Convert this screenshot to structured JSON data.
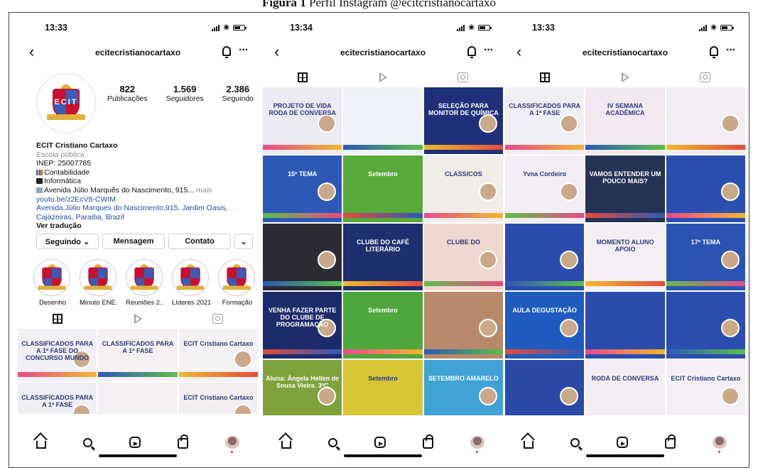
{
  "caption": {
    "bold": "Figura 1",
    "text": "Perfil Instagram @ecitcristianocartaxo"
  },
  "phones": [
    {
      "time": "13:33",
      "username": "ecitecristianocartaxo"
    },
    {
      "time": "13:34",
      "username": "ecitecristianocartaxo"
    },
    {
      "time": "13:33",
      "username": "ecitecristianocartaxo"
    }
  ],
  "profile": {
    "logo_letters": "ECIT",
    "stats": [
      {
        "value": "822",
        "label": "Publicações"
      },
      {
        "value": "1.569",
        "label": "Seguidores"
      },
      {
        "value": "2.386",
        "label": "Seguindo"
      }
    ],
    "name": "ECIT Cristiano Cartaxo",
    "category": "Escola pública",
    "inep": "INEP: 25007785",
    "line_contabilidade": "Contabilidade",
    "line_informatica": "Informática",
    "address_short": "Avenida Júlio Marquês do Nascimento, 915...",
    "more": "mais",
    "link": "youtu.be/z2EcV8-CWIM",
    "address_link": "Avenida Júlio Marques do Nascimento,915, Jardim Oasis, Cajàzeiras, Paraiba, Brazil",
    "translate": "Ver tradução",
    "buttons": {
      "following": "Seguindo ⌄",
      "message": "Mensagem",
      "contact": "Contato",
      "chevron": "⌄"
    },
    "highlights": [
      "Desenho",
      "Minuto ENE...",
      "Reuniões 2...",
      "Líderes 2021",
      "Formação"
    ]
  },
  "posts": {
    "p1": [
      {
        "text": "CLASSIFICADOS PARA A 1ª FASE DO CONCURSO MUNDO",
        "color": "#f3eff7"
      },
      {
        "text": "CLASSIFICADOS PARA A 1ª FASE",
        "color": "#f7f1f4"
      },
      {
        "text": "ECIT Cristiano Cartaxo",
        "color": "#f5f2f6"
      },
      {
        "text": "CLASSIFICADOS PARA A 1ª FASE",
        "color": "#efeef5"
      },
      {
        "text": "",
        "color": "#f4f0f4"
      },
      {
        "text": "ECIT Cristiano Cartaxo",
        "color": "#f4eef2"
      }
    ],
    "p2": [
      {
        "text": "PROJETO DE VIDA RODA DE CONVERSA",
        "color": "#ecebf4"
      },
      {
        "text": "",
        "color": "#eef1f7"
      },
      {
        "text": "SELEÇÃO PARA MONITOR DE QUÍMICA",
        "color": "#1f2f7a"
      },
      {
        "text": "15º TEMA",
        "color": "#2e58b5"
      },
      {
        "text": "Setembro",
        "color": "#57a93a"
      },
      {
        "text": "CLASSICOS",
        "color": "#f2ede8"
      },
      {
        "text": "",
        "color": "#2b2b36"
      },
      {
        "text": "CLUBE DO CAFÉ LITERÁRIO",
        "color": "#1d2f6e"
      },
      {
        "text": "CLUBE DO",
        "color": "#efd8cf"
      },
      {
        "text": "VENHA FAZER PARTE DO CLUBE DE PROGRAMAÇÃO",
        "color": "#1c2b6a"
      },
      {
        "text": "Setembro",
        "color": "#4ea73a"
      },
      {
        "text": "",
        "color": "#b78a6b"
      },
      {
        "text": "Aluna: Ângela Hellen de Sousa Vieira. 3ºC",
        "color": "#7ea33d"
      },
      {
        "text": "Setembro",
        "color": "#d8c534"
      },
      {
        "text": "SETEMBRO AMARELO",
        "color": "#3fa3d6"
      }
    ],
    "p3": [
      {
        "text": "CLASSIFICADOS PARA A 1ª FASE",
        "color": "#f1eef6"
      },
      {
        "text": "IV SEMANA ACADÊMICA",
        "color": "#f4e9f1"
      },
      {
        "text": "",
        "color": "#f3edf4"
      },
      {
        "text": "Yvna Cordeiro",
        "color": "#f2eef4"
      },
      {
        "text": "VAMOS ENTENDER UM POUCO MAIS?",
        "color": "#243355"
      },
      {
        "text": "",
        "color": "#2b4fb0"
      },
      {
        "text": "",
        "color": "#2a4dad"
      },
      {
        "text": "MOMENTO ALUNO APOIO",
        "color": "#f4eff4"
      },
      {
        "text": "17º TEMA",
        "color": "#2a53b3"
      },
      {
        "text": "AULA DEGUSTAÇÃO",
        "color": "#1f5bbf"
      },
      {
        "text": "",
        "color": "#2a4cad"
      },
      {
        "text": "",
        "color": "#2b4dad"
      },
      {
        "text": "",
        "color": "#2a4aa8"
      },
      {
        "text": "RODA DE CONVERSA",
        "color": "#f3eef4"
      },
      {
        "text": "ECIT Cristiano Cartaxo",
        "color": "#f4f0f5"
      }
    ]
  }
}
